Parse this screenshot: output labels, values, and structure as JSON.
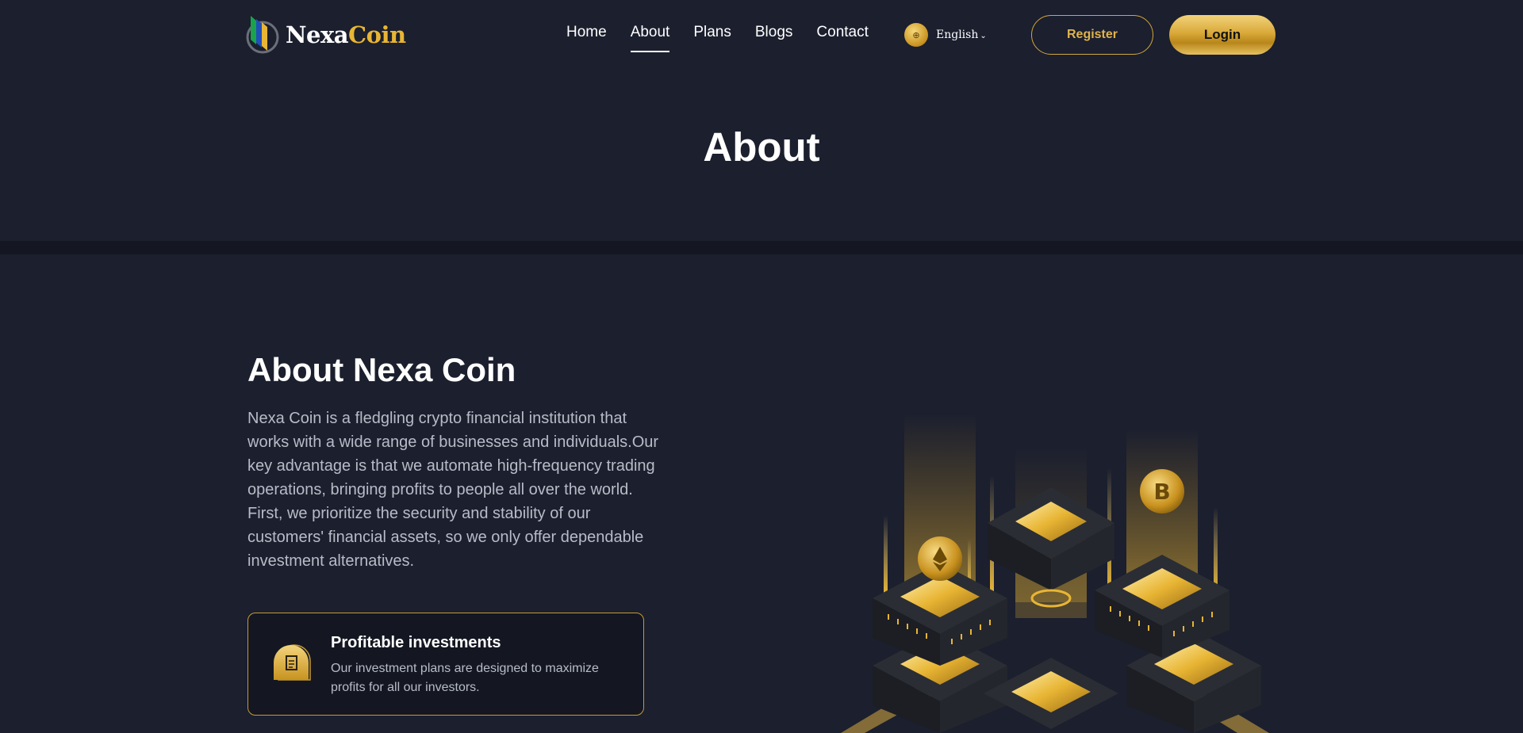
{
  "brand": {
    "name_part1": "Nexa",
    "name_part2": "Coin",
    "accent_color": "#e8b534"
  },
  "nav": {
    "items": [
      {
        "label": "Home",
        "active": false
      },
      {
        "label": "About",
        "active": true
      },
      {
        "label": "Plans",
        "active": false
      },
      {
        "label": "Blogs",
        "active": false
      },
      {
        "label": "Contact",
        "active": false
      }
    ]
  },
  "language": {
    "icon": "globe-icon",
    "selected": "English"
  },
  "auth": {
    "register_label": "Register",
    "login_label": "Login"
  },
  "banner": {
    "title": "About"
  },
  "about": {
    "heading": "About Nexa Coin",
    "body": "Nexa Coin is a fledgling crypto financial institution that works with a wide range of businesses and individuals.Our key advantage is that we automate high-frequency trading operations, bringing profits to people all over the world. First, we prioritize the security and stability of our customers' financial assets, so we only offer dependable investment alternatives."
  },
  "feature": {
    "icon": "document-icon",
    "title": "Profitable investments",
    "description": "Our investment plans are designed to maximize profits for all our investors."
  },
  "colors": {
    "background": "#1b1f2e",
    "gold": "#d4a63a",
    "text_muted": "#b8bcc8"
  }
}
